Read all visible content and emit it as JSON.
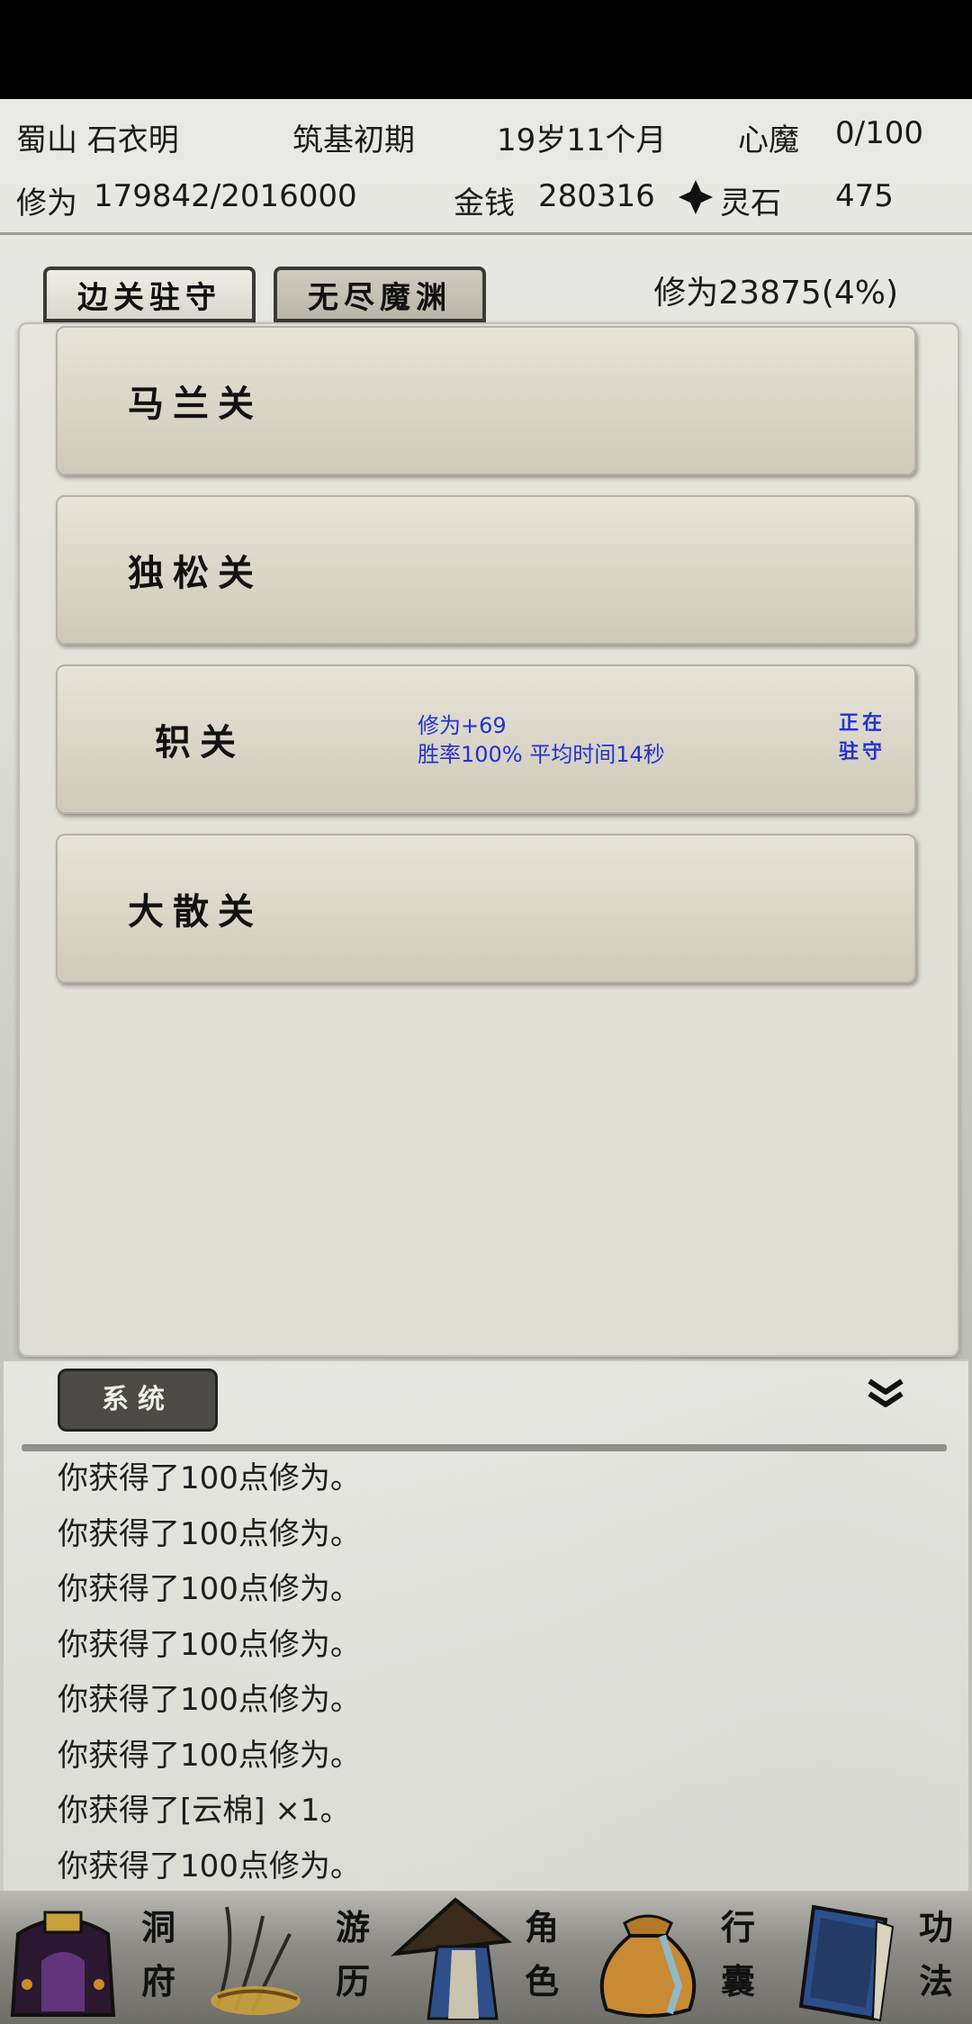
{
  "status": {
    "sect_name": "蜀山 石衣明",
    "realm": "筑基初期",
    "age": "19岁11个月",
    "demon_label": "心魔",
    "demon_value": "0/100",
    "cultivation_label": "修为",
    "cultivation_value": "179842/2016000",
    "money_label": "金钱",
    "money_value": "280316",
    "stone_label": "灵石",
    "stone_value": "475"
  },
  "tabs": {
    "active": "边关驻守",
    "inactive": "无尽魔渊"
  },
  "cultivation_rate": "修为23875(4%)",
  "passes": [
    {
      "name": "马兰关",
      "reward": "",
      "stats": "",
      "state_line1": "",
      "state_line2": ""
    },
    {
      "name": "独松关",
      "reward": "",
      "stats": "",
      "state_line1": "",
      "state_line2": ""
    },
    {
      "name": "轵关",
      "reward": "修为+69",
      "stats": "胜率100% 平均时间14秒",
      "state_line1": "正在",
      "state_line2": "驻守"
    },
    {
      "name": "大散关",
      "reward": "",
      "stats": "",
      "state_line1": "",
      "state_line2": ""
    }
  ],
  "log": {
    "tab_label": "系统",
    "lines": [
      "你获得了100点修为。",
      "你获得了100点修为。",
      "你获得了100点修为。",
      "你获得了100点修为。",
      "你获得了100点修为。",
      "你获得了100点修为。",
      "你获得了[云棉] ×1。",
      "你获得了100点修为。"
    ]
  },
  "nav": [
    {
      "label1": "洞",
      "label2": "府",
      "icon": "cave-mansion-icon"
    },
    {
      "label1": "游",
      "label2": "历",
      "icon": "travel-icon"
    },
    {
      "label1": "角",
      "label2": "色",
      "icon": "character-icon"
    },
    {
      "label1": "行",
      "label2": "囊",
      "icon": "bag-icon"
    },
    {
      "label1": "功",
      "label2": "法",
      "icon": "technique-book-icon"
    }
  ],
  "colors": {
    "accent_blue": "#2233cc",
    "panel": "#e6e5dc",
    "tab_dark": "#4b4a47"
  }
}
